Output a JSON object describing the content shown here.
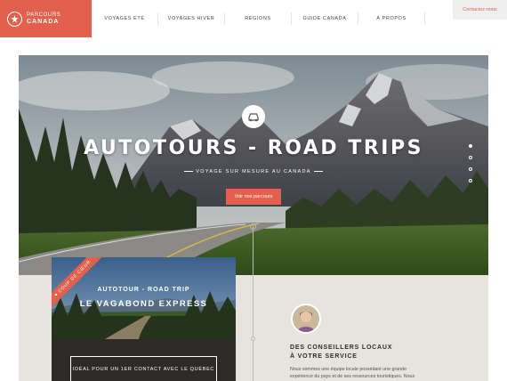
{
  "logo": {
    "small": "PARCOURS",
    "big": "CANADA"
  },
  "nav": [
    "VOYAGES ÉTÉ",
    "VOYAGES HIVER",
    "RÉGIONS",
    "GUIDE CANADA",
    "À PROPOS"
  ],
  "contact_label": "Contactez-nous",
  "hero": {
    "title": "AUTOTOURS - ROAD TRIPS",
    "subtitle": "VOYAGE SUR MESURE AU CANADA",
    "button": "Voir nos parcours",
    "icon": "car-icon",
    "slides": 4,
    "active_slide": 0
  },
  "card": {
    "ribbon": "COUP DE CŒUR",
    "title1": "AUTOTOUR - ROAD TRIP",
    "title2": "LE VAGABOND EXPRESS",
    "box_text": "IDÉAL POUR UN 1ER CONTACT AVEC LE QUÉBEC"
  },
  "advisor": {
    "title_line1": "DES CONSEILLERS LOCAUX",
    "title_line2": "À VOTRE SERVICE",
    "text": "Nous sommes une équipe locale possédant une grande expérience du pays et de ses ressources touristiques. Nous"
  },
  "colors": {
    "accent": "#e2604e",
    "panel": "#e6e4dc",
    "card": "#2c2b29"
  }
}
